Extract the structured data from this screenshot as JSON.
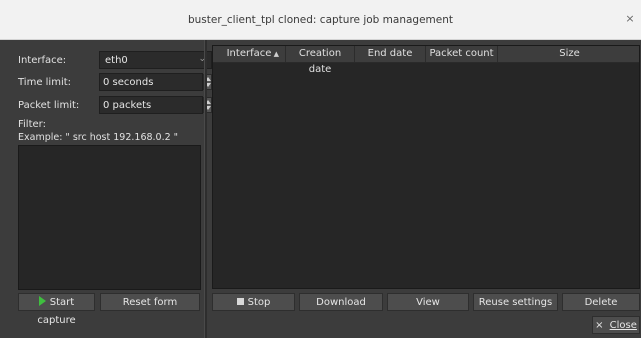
{
  "window": {
    "title": "buster_client_tpl cloned: capture job management",
    "close_icon": "×"
  },
  "form": {
    "interface_label": "Interface:",
    "interface_value": "eth0",
    "time_limit_label": "Time limit:",
    "time_limit_value": "0 seconds",
    "packet_limit_label": "Packet limit:",
    "packet_limit_value": "0 packets",
    "filter_label": "Filter:",
    "filter_example": "Example: \" src host 192.168.0.2 \""
  },
  "table": {
    "columns": [
      "Interface",
      "Creation date",
      "End date",
      "Packet count",
      "Size"
    ],
    "sort_column": "Interface",
    "rows": []
  },
  "buttons": {
    "start_capture": "Start capture",
    "reset_form": "Reset form",
    "stop": "Stop",
    "download": "Download",
    "view": "View",
    "reuse_settings": "Reuse settings",
    "delete": "Delete",
    "close_prefix": "× ",
    "close": "Close"
  },
  "colors": {
    "start_icon": "#3fbf3f",
    "background": "#3c3c3c"
  }
}
